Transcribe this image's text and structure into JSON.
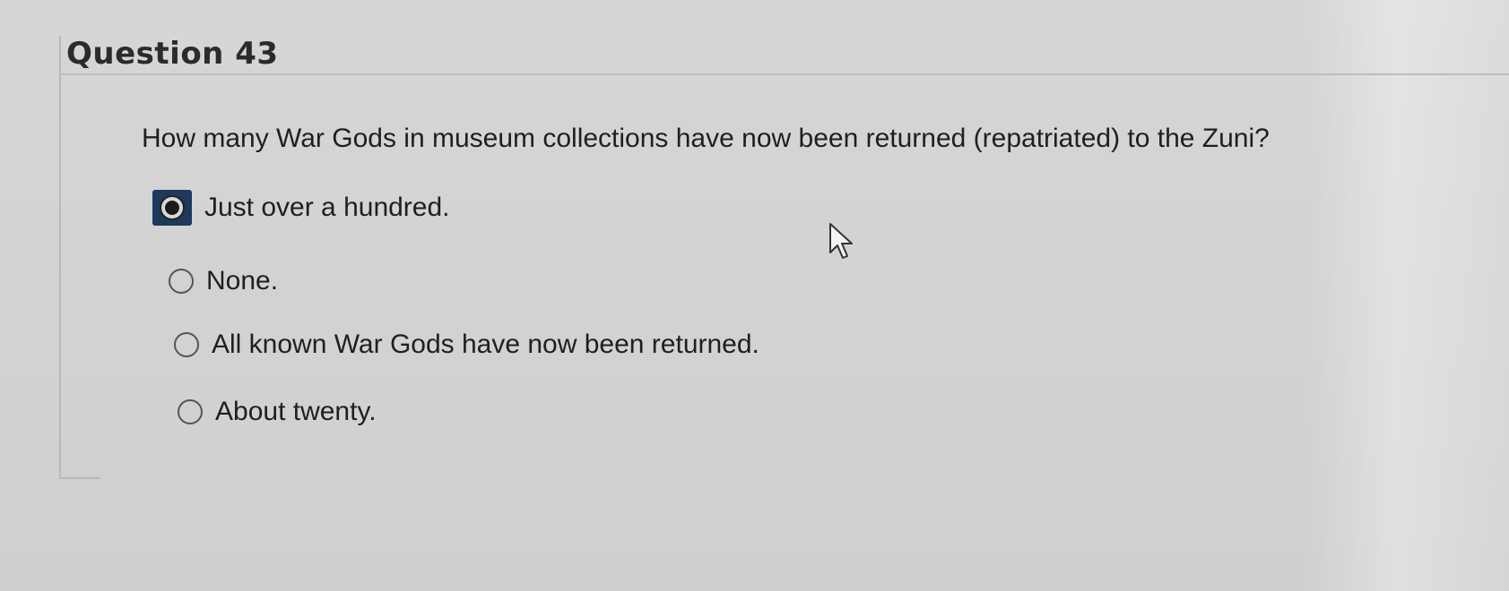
{
  "question": {
    "title": "Question 43",
    "text": "How many War Gods in museum collections have now been returned (repatriated) to the Zuni?"
  },
  "choices": [
    {
      "label": "Just over a hundred.",
      "selected": true
    },
    {
      "label": "None.",
      "selected": false
    },
    {
      "label": "All known War Gods have now been returned.",
      "selected": false
    },
    {
      "label": "About twenty.",
      "selected": false
    }
  ],
  "icons": {
    "cursor": "mouse-pointer-icon"
  },
  "colors": {
    "selected_radio_bg": "#1d3a5c"
  }
}
